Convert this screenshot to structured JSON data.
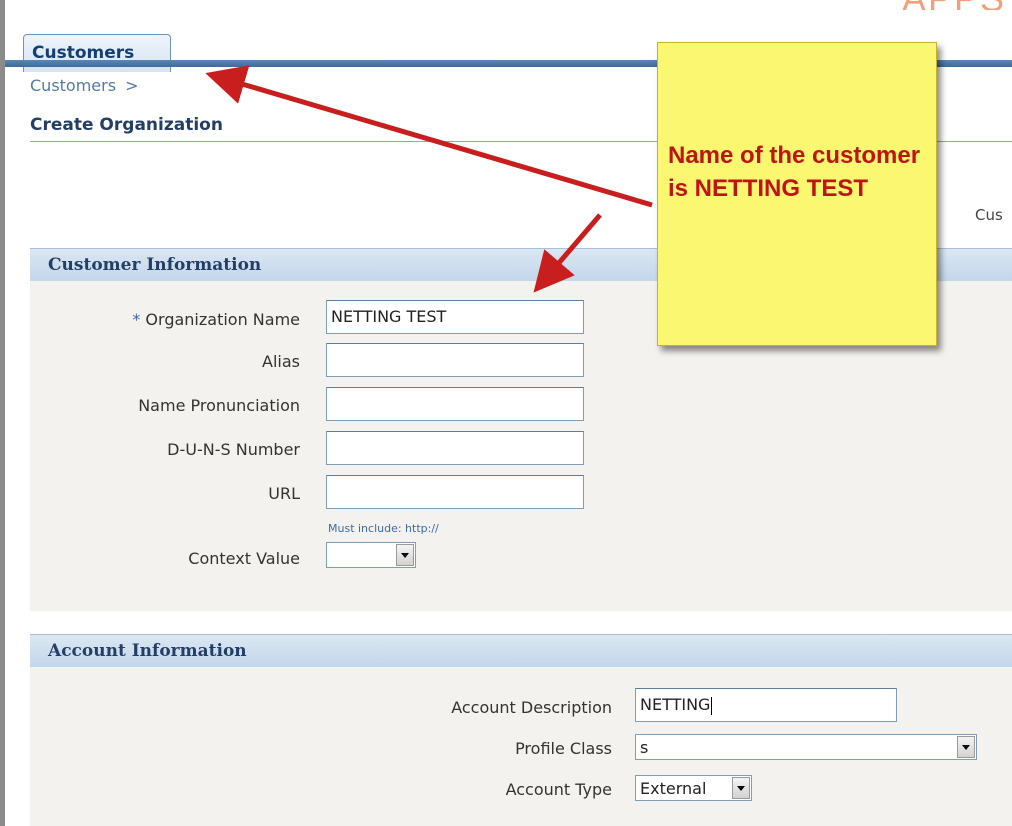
{
  "tabs": {
    "active": "Customers"
  },
  "breadcrumb": {
    "link": "Customers",
    "separator": ">"
  },
  "page": {
    "title": "Create Organization",
    "truncated_label": "Cus"
  },
  "customer_info": {
    "header": "Customer Information",
    "required_marker": "*",
    "fields": {
      "organization_name": {
        "label": "Organization Name",
        "value": "NETTING TEST"
      },
      "alias": {
        "label": "Alias",
        "value": ""
      },
      "name_pronunciation": {
        "label": "Name Pronunciation",
        "value": ""
      },
      "duns_number": {
        "label": "D-U-N-S Number",
        "value": ""
      },
      "url": {
        "label": "URL",
        "value": "",
        "hint": "Must include: http://"
      },
      "context_value": {
        "label": "Context Value",
        "value": ""
      }
    }
  },
  "account_info": {
    "header": "Account Information",
    "fields": {
      "account_description": {
        "label": "Account Description",
        "value": "NETTING"
      },
      "profile_class": {
        "label": "Profile Class",
        "value": "s"
      },
      "account_type": {
        "label": "Account Type",
        "value": "External"
      }
    }
  },
  "callout": {
    "text": "Name of the customer is NETTING TEST"
  },
  "colors": {
    "tab_bar": "#3e6a9c",
    "section_header": "#c3d6ea",
    "section_body": "#f3f2ee",
    "callout_bg": "#fbf770",
    "callout_text": "#c01414",
    "arrow": "#c81e1e",
    "link": "#4f7bb0"
  },
  "icons": {
    "dropdown": "chevron-down-icon"
  }
}
